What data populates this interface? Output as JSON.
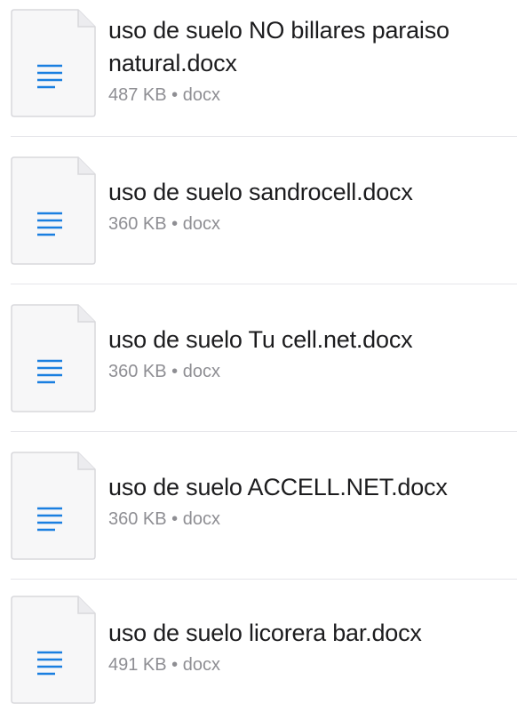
{
  "files": [
    {
      "name_line1": "uso de suelo NO billares paraiso",
      "name_line2": "natural.docx",
      "size": "487 KB",
      "separator": "•",
      "type": "docx",
      "icon": "document-icon"
    },
    {
      "name_line1": "uso de suelo sandrocell.docx",
      "name_line2": "",
      "size": "360 KB",
      "separator": "•",
      "type": "docx",
      "icon": "document-icon"
    },
    {
      "name_line1": "uso de suelo Tu cell.net.docx",
      "name_line2": "",
      "size": "360 KB",
      "separator": "•",
      "type": "docx",
      "icon": "document-icon"
    },
    {
      "name_line1": "uso de suelo ACCELL.NET.docx",
      "name_line2": "",
      "size": "360 KB",
      "separator": "•",
      "type": "docx",
      "icon": "document-icon"
    },
    {
      "name_line1": "uso de suelo licorera bar.docx",
      "name_line2": "",
      "size": "491 KB",
      "separator": "•",
      "type": "docx",
      "icon": "document-icon"
    }
  ],
  "colors": {
    "icon_lines": "#1a7fe0",
    "icon_border": "#d8d8dc",
    "icon_fill": "#f7f7f8",
    "meta_text": "#8e8e93",
    "separator": "#e5e5ea"
  }
}
